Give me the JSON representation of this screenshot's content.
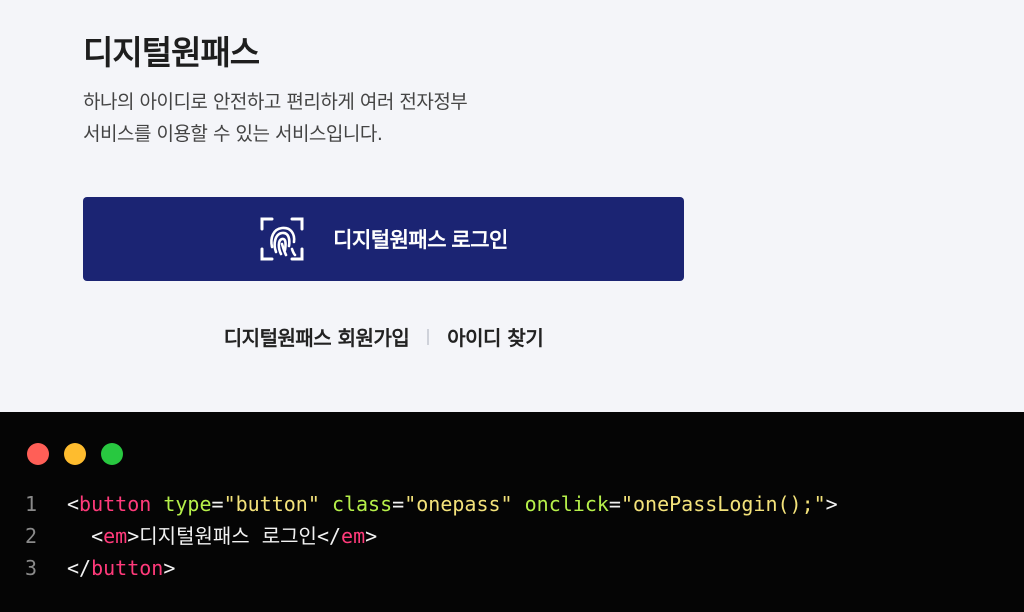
{
  "page": {
    "title": "디지털원패스",
    "description": "하나의 아이디로 안전하고 편리하게 여러 전자정부\n서비스를 이용할 수 있는 서비스입니다.",
    "login_button_label": "디지털원패스 로그인",
    "login_icon": "fingerprint-scan-icon",
    "links": {
      "signup": "디지털원패스 회원가입",
      "find_id": "아이디 찾기"
    }
  },
  "code_window": {
    "dot_colors": [
      "#ff5f57",
      "#febc2e",
      "#28c840"
    ],
    "line_numbers": [
      "1",
      "2",
      "3"
    ],
    "tokens": {
      "lt": "<",
      "gt": ">",
      "lt_slash": "</",
      "eq": "=",
      "space": " ",
      "indent": "  ",
      "button_tag": "button",
      "em_tag": "em",
      "attr_type": "type",
      "attr_class": "class",
      "attr_onclick": "onclick",
      "val_type": "\"button\"",
      "val_class": "\"onepass\"",
      "val_onclick": "\"onePassLogin();\"",
      "em_text": "디지털원패스 로그인"
    }
  },
  "colors": {
    "button_bg": "#1b2473",
    "page_bg": "#f4f5f9",
    "code_bg": "#050505",
    "tag_color": "#ff3a7a",
    "attr_color": "#b6f04a",
    "string_color": "#f3e27a"
  }
}
